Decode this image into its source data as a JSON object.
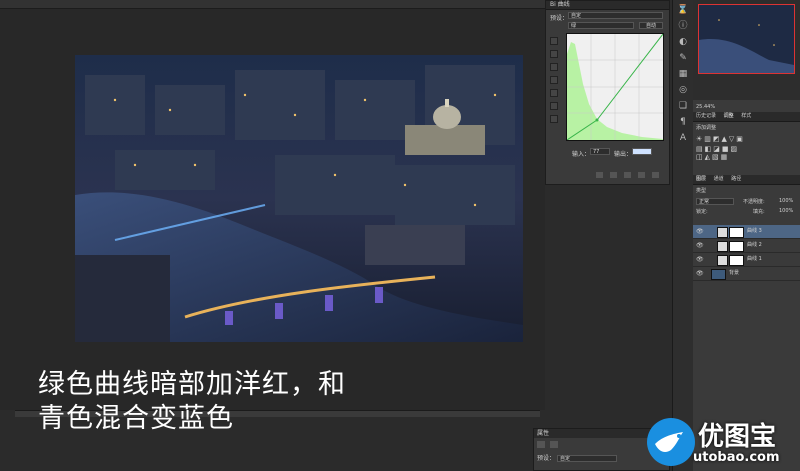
{
  "curves": {
    "header": "Bi 曲线",
    "preset_label": "预设：",
    "preset_value": "自定",
    "channel_value": "绿",
    "auto_label": "自动",
    "input_label": "输入：",
    "input_value": "77",
    "output_label": "输出：",
    "output_value": "",
    "tools": [
      "hand-icon",
      "eyedropper-black-icon",
      "eyedropper-gray-icon",
      "eyedropper-white-icon",
      "curve-point-icon",
      "pencil-icon",
      "smooth-icon"
    ]
  },
  "navigator": {
    "zoom": "25.44%"
  },
  "adjustments": {
    "tabs": [
      "历史记录",
      "调整",
      "样式"
    ],
    "add_label": "添加调整"
  },
  "layers": {
    "tabs": [
      "图层",
      "通道",
      "路径"
    ],
    "kind_label": "类型",
    "blend_mode": "正常",
    "opacity_label": "不透明度:",
    "opacity_value": "100%",
    "lock_label": "锁定:",
    "fill_label": "填充:",
    "fill_value": "100%",
    "items": [
      {
        "name": "曲线 3",
        "selected": true
      },
      {
        "name": "曲线 2",
        "selected": false
      },
      {
        "name": "曲线 1",
        "selected": false
      },
      {
        "name": "背景",
        "selected": false
      }
    ]
  },
  "properties_mini": {
    "title": "属性",
    "preset_label": "预设：",
    "preset_value": "自定"
  },
  "caption": {
    "line1": "绿色曲线暗部加洋红，和",
    "line2": "青色混合变蓝色"
  },
  "watermark": {
    "brand": "优图宝",
    "url": "utobao.com"
  },
  "colors": {
    "histogram_fill": "#b8f2a4",
    "curve_line": "#39b54a",
    "layer_selected": "#4d6685",
    "nav_frame": "#dd3333"
  }
}
